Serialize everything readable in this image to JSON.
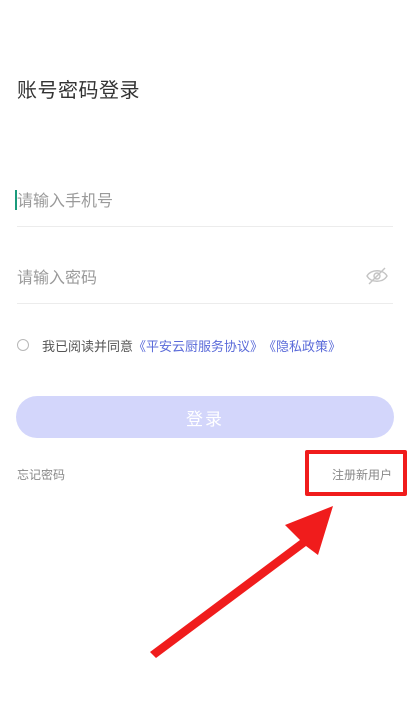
{
  "login": {
    "title": "账号密码登录",
    "phone_placeholder": "请输入手机号",
    "password_placeholder": "请输入密码",
    "agreement_prefix": "我已阅读并同意",
    "service_agreement": "《平安云厨服务协议》",
    "privacy_policy": "《隐私政策》",
    "login_label": "登录",
    "forgot_password": "忘记密码",
    "register": "注册新用户"
  },
  "icons": {
    "password_toggle": "eye-off-icon",
    "agreement_checkbox": "radio-unchecked-icon"
  },
  "colors": {
    "accent": "#5b6bd9",
    "login_button_disabled": "#d3d6fb",
    "annotation_red": "#f01c1c",
    "caret": "#1a9b7c"
  }
}
